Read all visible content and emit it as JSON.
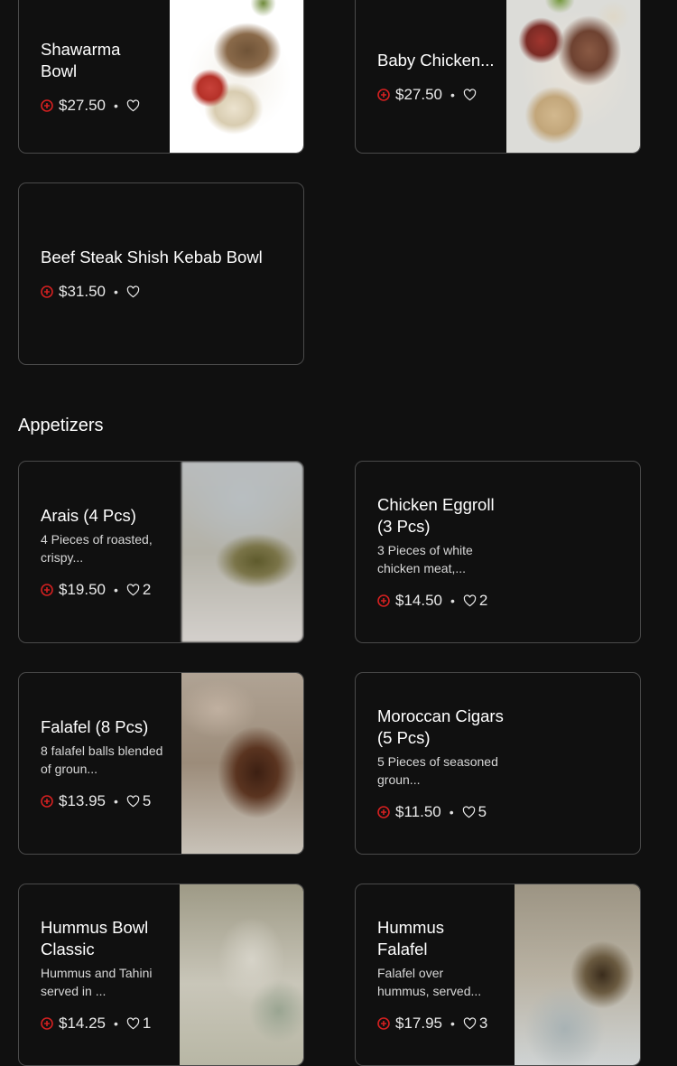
{
  "colors": {
    "background": "#101010",
    "border": "#4a4a4a",
    "add_icon": "#d32020",
    "text": "#ffffff"
  },
  "top_cards": [
    {
      "title": "Shawarma Bowl",
      "price": "$27.50",
      "likes": ""
    },
    {
      "title": "Baby Chicken...",
      "price": "$27.50",
      "likes": ""
    },
    {
      "title": "Beef Steak Shish Kebab Bowl",
      "price": "$31.50",
      "likes": ""
    }
  ],
  "appetizers": {
    "heading": "Appetizers",
    "items": [
      {
        "title": "Arais (4 Pcs)",
        "description": "4 Pieces of roasted, crispy...",
        "price": "$19.50",
        "likes": "2"
      },
      {
        "title": "Chicken Eggroll (3 Pcs)",
        "description": "3 Pieces of white chicken meat,...",
        "price": "$14.50",
        "likes": "2"
      },
      {
        "title": "Falafel (8 Pcs)",
        "description": "8 falafel balls blended of groun...",
        "price": "$13.95",
        "likes": "5"
      },
      {
        "title": "Moroccan Cigars (5 Pcs)",
        "description": "5 Pieces of seasoned groun...",
        "price": "$11.50",
        "likes": "5"
      },
      {
        "title": "Hummus Bowl Classic",
        "description": "Hummus and Tahini served in ...",
        "price": "$14.25",
        "likes": "1"
      },
      {
        "title": "Hummus Falafel",
        "description": "Falafel over hummus, served...",
        "price": "$17.95",
        "likes": "3"
      }
    ]
  },
  "icons": {
    "add": "plus-circle-icon",
    "like": "heart-outline-icon",
    "separator": "•"
  }
}
